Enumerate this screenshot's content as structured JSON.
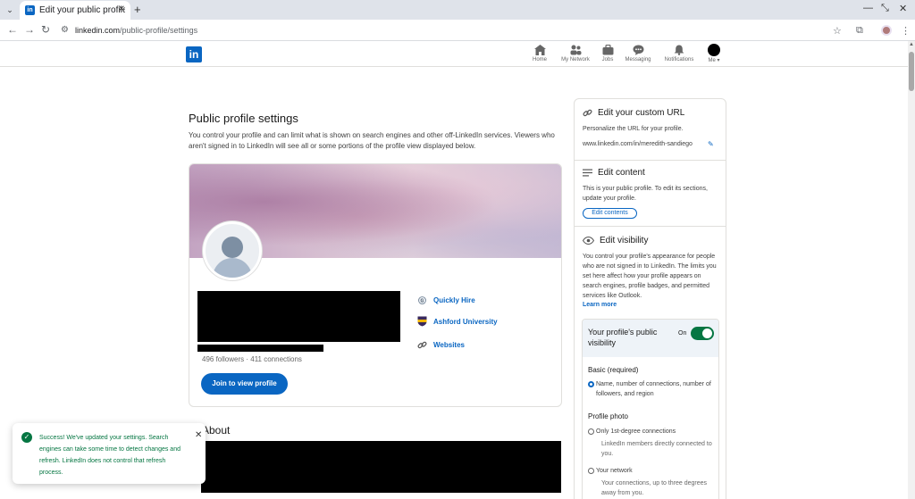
{
  "browser": {
    "tab_title": "Edit your public profile",
    "url_domain": "linkedin.com",
    "url_path": "/public-profile/settings"
  },
  "nav": {
    "items": [
      {
        "label": "Home",
        "icon": "home-icon"
      },
      {
        "label": "My Network",
        "icon": "people-icon"
      },
      {
        "label": "Jobs",
        "icon": "briefcase-icon"
      },
      {
        "label": "Messaging",
        "icon": "chat-icon"
      },
      {
        "label": "Notifications",
        "icon": "bell-icon"
      },
      {
        "label": "Me",
        "icon": "avatar"
      }
    ]
  },
  "main": {
    "title": "Public profile settings",
    "description": "You control your profile and can limit what is shown on search engines and other off-LinkedIn services. Viewers who aren't signed in to LinkedIn will see all or some portions of the profile view displayed below.",
    "stats": "496 followers  ·  411 connections",
    "join_button": "Join to view profile",
    "links": [
      {
        "label": "Quickly Hire",
        "icon": "company-logo-icon"
      },
      {
        "label": "Ashford University",
        "icon": "school-shield-icon"
      },
      {
        "label": "Websites",
        "icon": "link-icon"
      }
    ],
    "about_title": "About"
  },
  "toast": {
    "message": "Success! We've updated your settings. Search engines can take some time to detect changes and refresh. LinkedIn does not control that refresh process."
  },
  "sidebar": {
    "custom_url": {
      "title": "Edit your custom URL",
      "desc": "Personalize the URL for your profile.",
      "url": "www.linkedin.com/in/meredith-sandiego"
    },
    "content": {
      "title": "Edit content",
      "desc": "This is your public profile. To edit its sections, update your profile.",
      "button": "Edit contents"
    },
    "visibility": {
      "title": "Edit visibility",
      "desc": "You control your profile's appearance for people who are not signed in to LinkedIn. The limits you set here affect how your profile appears on search engines, profile badges, and permitted services like Outlook.",
      "learn_more": "Learn more",
      "box_title": "Your profile's public visibility",
      "toggle_label": "On",
      "basic_label": "Basic (required)",
      "basic_option": "Name, number of connections, number of followers, and region",
      "photo_label": "Profile photo",
      "photo_opt1": "Only 1st-degree connections",
      "photo_opt1_desc": "LinkedIn members directly connected to you.",
      "photo_opt2": "Your network",
      "photo_opt2_desc": "Your connections, up to three degrees away from you."
    }
  },
  "colors": {
    "brand": "#0a66c2",
    "success": "#057642"
  }
}
